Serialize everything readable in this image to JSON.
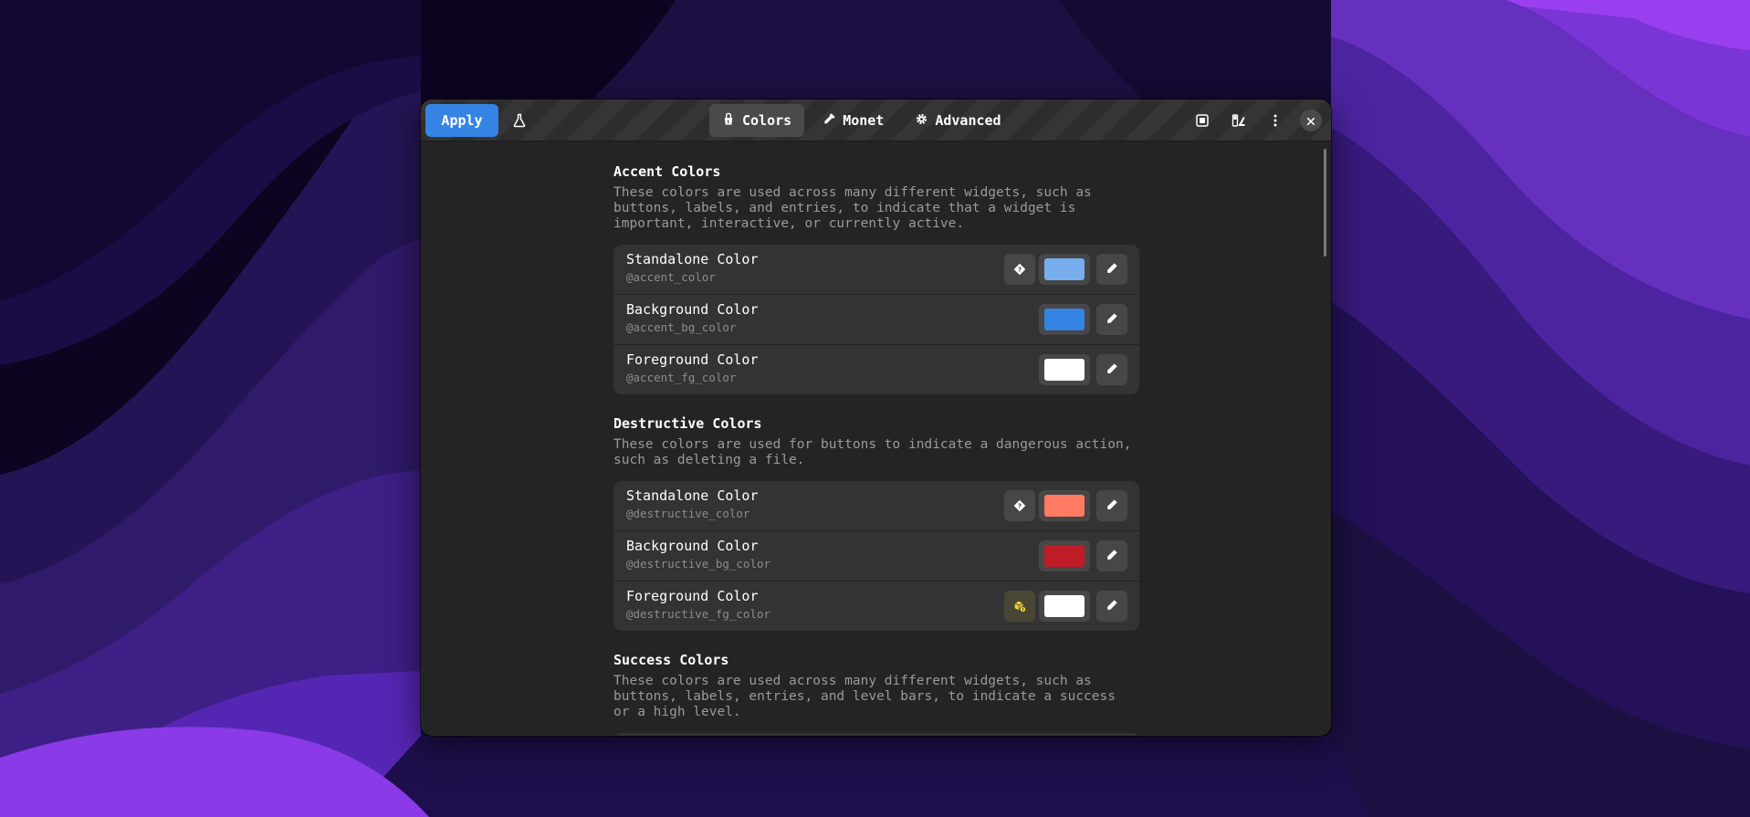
{
  "header": {
    "apply_label": "Apply",
    "tabs": [
      {
        "label": "Colors",
        "icon": "paint-bucket-icon",
        "active": true
      },
      {
        "label": "Monet",
        "icon": "eyedropper-icon",
        "active": false
      },
      {
        "label": "Advanced",
        "icon": "gear-icon",
        "active": false
      }
    ],
    "right_icons": [
      "screenshot-icon",
      "palette-icon",
      "kebab-menu-icon",
      "close-icon"
    ],
    "left_icons": [
      "flask-icon"
    ]
  },
  "sections": [
    {
      "title": "Accent Colors",
      "description": "These colors are used across many different widgets, such as\nbuttons, labels, and entries, to indicate that a widget is\nimportant, interactive, or currently active.",
      "rows": [
        {
          "title": "Standalone Color",
          "variable": "@accent_color",
          "color": "#78aeed",
          "info": "contrast-help-icon"
        },
        {
          "title": "Background Color",
          "variable": "@accent_bg_color",
          "color": "#3584e4",
          "info": ""
        },
        {
          "title": "Foreground Color",
          "variable": "@accent_fg_color",
          "color": "#ffffff",
          "info": ""
        }
      ]
    },
    {
      "title": "Destructive Colors",
      "description": "These colors are used for buttons to indicate a dangerous action,\nsuch as deleting a file.",
      "rows": [
        {
          "title": "Standalone Color",
          "variable": "@destructive_color",
          "color": "#ff7b63",
          "info": "contrast-help-icon"
        },
        {
          "title": "Background Color",
          "variable": "@destructive_bg_color",
          "color": "#c01c28",
          "info": ""
        },
        {
          "title": "Foreground Color",
          "variable": "@destructive_fg_color",
          "color": "#ffffff",
          "info": "contrast-warning-icon"
        }
      ]
    },
    {
      "title": "Success Colors",
      "description": "These colors are used across many different widgets, such as\nbuttons, labels, entries, and level bars, to indicate a success\nor a high level.",
      "rows": []
    }
  ],
  "colors": {
    "accent": "#3584e4",
    "window_bg": "#242424",
    "card_bg": "#333333",
    "headerbar_bg": "#303030"
  }
}
